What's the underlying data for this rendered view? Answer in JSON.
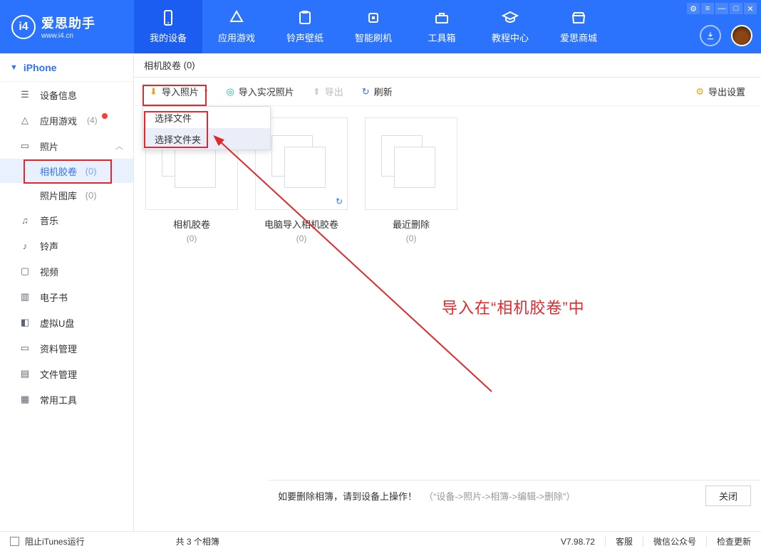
{
  "app": {
    "name": "爱思助手",
    "domain": "www.i4.cn",
    "logo_letter": "i4"
  },
  "nav": {
    "items": [
      {
        "label": "我的设备"
      },
      {
        "label": "应用游戏"
      },
      {
        "label": "铃声壁纸"
      },
      {
        "label": "智能刷机"
      },
      {
        "label": "工具箱"
      },
      {
        "label": "教程中心"
      },
      {
        "label": "爱思商城"
      }
    ]
  },
  "sidebar": {
    "device": "iPhone",
    "items": [
      {
        "label": "设备信息"
      },
      {
        "label": "应用游戏",
        "count": "(4)",
        "reddot": true
      },
      {
        "label": "照片"
      },
      {
        "label": "音乐"
      },
      {
        "label": "铃声"
      },
      {
        "label": "视频"
      },
      {
        "label": "电子书"
      },
      {
        "label": "虚拟U盘"
      },
      {
        "label": "资料管理"
      },
      {
        "label": "文件管理"
      },
      {
        "label": "常用工具"
      }
    ],
    "photo_children": [
      {
        "label": "相机胶卷",
        "count": "(0)"
      },
      {
        "label": "照片图库",
        "count": "(0)"
      }
    ]
  },
  "crumb": {
    "title": "相机胶卷",
    "count": "(0)"
  },
  "toolbar": {
    "import_photo": "导入照片",
    "import_live": "导入实况照片",
    "export": "导出",
    "refresh": "刷新",
    "export_settings": "导出设置",
    "dropdown": {
      "file": "选择文件",
      "folder": "选择文件夹"
    }
  },
  "albums": [
    {
      "name": "相机胶卷",
      "count": "(0)"
    },
    {
      "name": "电脑导入相机胶卷",
      "count": "(0)",
      "cloud": true
    },
    {
      "name": "最近删除",
      "count": "(0)"
    }
  ],
  "annotation": {
    "text": "导入在“相机胶卷”中"
  },
  "infobar": {
    "msg": "如要删除相簿，请到设备上操作！",
    "hint": "（“设备->照片->相簿->编辑->删除”）",
    "close": "关闭"
  },
  "status": {
    "block_itunes": "阻止iTunes运行",
    "album_count": "共 3 个相簿",
    "version": "V7.98.72",
    "links": [
      "客服",
      "微信公众号",
      "检查更新"
    ]
  }
}
